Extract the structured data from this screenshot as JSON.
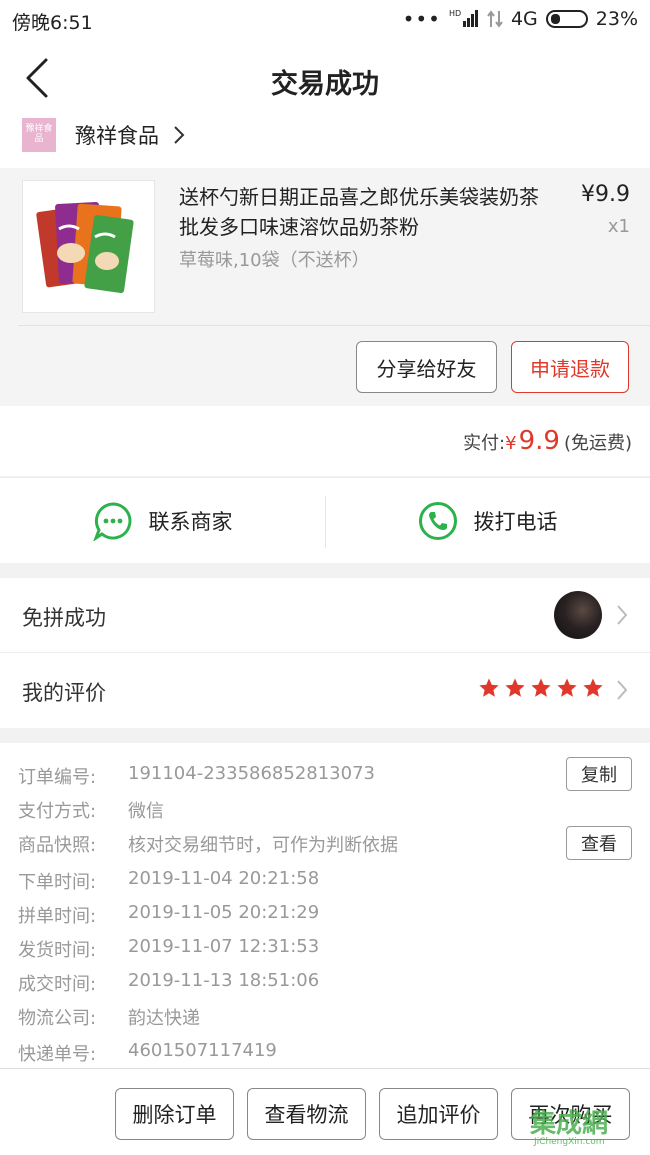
{
  "status_bar": {
    "time": "傍晚6:51",
    "network": "4G",
    "battery": "23%",
    "hd_label": "HD"
  },
  "nav": {
    "title": "交易成功"
  },
  "shop": {
    "logo_text": "豫祥食品",
    "name": "豫祥食品"
  },
  "product": {
    "title": "送杯勺新日期正品喜之郎优乐美袋装奶茶批发多口味速溶饮品奶茶粉",
    "spec": "草莓味,10袋（不送杯）",
    "price": "¥9.9",
    "qty": "x1",
    "share_label": "分享给好友",
    "refund_label": "申请退款"
  },
  "payment": {
    "label": "实付:",
    "currency": "¥",
    "amount": "9.9",
    "note": "(免运费)"
  },
  "contact": {
    "merchant_label": "联系商家",
    "call_label": "拨打电话"
  },
  "group": {
    "status_label": "免拼成功",
    "review_label": "我的评价",
    "rating": 5
  },
  "order": {
    "rows": [
      {
        "label": "订单编号:",
        "value": "191104-233586852813073"
      },
      {
        "label": "支付方式:",
        "value": "微信"
      },
      {
        "label": "商品快照:",
        "value": "核对交易细节时，可作为判断依据"
      },
      {
        "label": "下单时间:",
        "value": "2019-11-04 20:21:58"
      },
      {
        "label": "拼单时间:",
        "value": "2019-11-05 20:21:29"
      },
      {
        "label": "发货时间:",
        "value": "2019-11-07 12:31:53"
      },
      {
        "label": "成交时间:",
        "value": "2019-11-13 18:51:06"
      },
      {
        "label": "物流公司:",
        "value": "韵达快递"
      },
      {
        "label": "快递单号:",
        "value": "4601507117419"
      }
    ],
    "copy_label": "复制",
    "view_label": "查看"
  },
  "actions": {
    "delete": "删除订单",
    "logistics": "查看物流",
    "add_review": "追加评价",
    "rebuy": "再次购买"
  },
  "watermark": {
    "cn": "集成網",
    "en": "JiChengXin.com"
  },
  "colors": {
    "accent_red": "#e0392b",
    "wechat_green": "#2bb24c"
  }
}
